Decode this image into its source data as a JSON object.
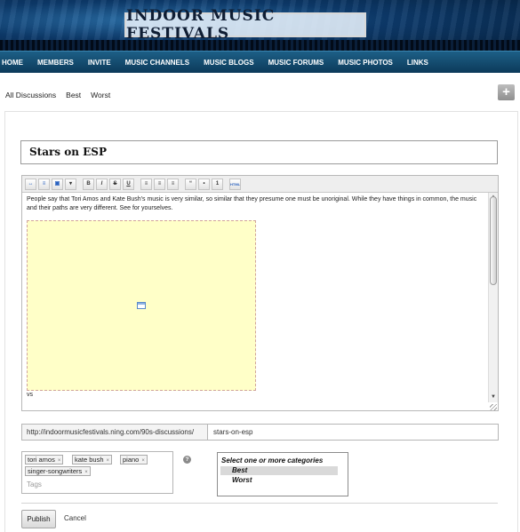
{
  "header": {
    "logo_text": "INDOOR MUSIC FESTIVALS"
  },
  "nav": {
    "items": [
      {
        "label": "HOME"
      },
      {
        "label": "MEMBERS"
      },
      {
        "label": "INVITE"
      },
      {
        "label": "MUSIC CHANNELS"
      },
      {
        "label": "MUSIC BLOGS"
      },
      {
        "label": "MUSIC FORUMS"
      },
      {
        "label": "MUSIC PHOTOS"
      },
      {
        "label": "LINKS"
      }
    ]
  },
  "subnav": {
    "links": [
      "All Discussions",
      "Best",
      "Worst"
    ],
    "add_button": "+"
  },
  "form": {
    "title_value": "Stars on ESP",
    "editor": {
      "body_text": "People say that Tori Amos and Kate Bush's music is very similar, so similar that they presume one must be unoriginal. While they have things in common, the music and their paths are very different. See for yourselves.",
      "trailing_text": "vs",
      "toolbar_buttons": [
        {
          "icon": "link-icon",
          "glyph": "↔"
        },
        {
          "icon": "unlink-icon",
          "glyph": "≡"
        },
        {
          "icon": "image-icon",
          "glyph": "▣"
        },
        {
          "icon": "video-icon",
          "glyph": "▾"
        },
        {
          "icon": "bold-icon",
          "glyph": "B"
        },
        {
          "icon": "italic-icon",
          "glyph": "I"
        },
        {
          "icon": "strikethrough-icon",
          "glyph": "S"
        },
        {
          "icon": "underline-icon",
          "glyph": "U"
        },
        {
          "icon": "align-left-icon",
          "glyph": "≡"
        },
        {
          "icon": "align-center-icon",
          "glyph": "≡"
        },
        {
          "icon": "align-right-icon",
          "glyph": "≡"
        },
        {
          "icon": "blockquote-icon",
          "glyph": "“"
        },
        {
          "icon": "bullet-list-icon",
          "glyph": "•"
        },
        {
          "icon": "numbered-list-icon",
          "glyph": "1"
        },
        {
          "icon": "html-icon",
          "glyph": "HTML"
        }
      ],
      "scroll_up": "▲",
      "scroll_down": "▼"
    },
    "url": {
      "prefix": "http://indoormusicfestivals.ning.com/90s-discussions/",
      "slug": "stars-on-esp"
    },
    "tags": {
      "items": [
        "tori amos",
        "kate bush",
        "piano",
        "singer-songwriters"
      ],
      "remove_glyph": "×",
      "placeholder": "Tags",
      "help_glyph": "?"
    },
    "categories": {
      "header": "Select one or more categories",
      "options": [
        "Best",
        "Worst"
      ],
      "selected": "Best"
    },
    "publish_label": "Publish",
    "cancel_label": "Cancel"
  }
}
